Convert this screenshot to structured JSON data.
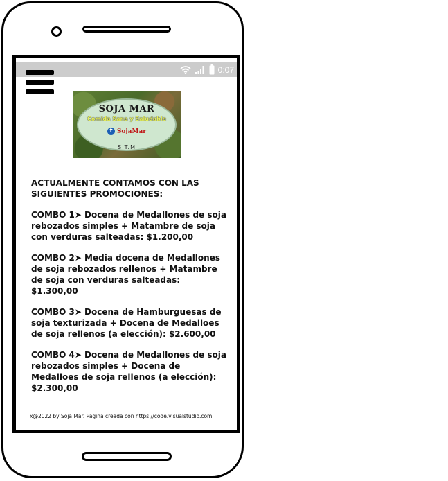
{
  "status_bar": {
    "icons": [
      "wifi-icon",
      "signal-icon",
      "battery-icon"
    ],
    "time": "0:07"
  },
  "logo": {
    "title": "SOJA MAR",
    "subtitle": "Comida Sana y Saludable",
    "social_handle": "SojaMar",
    "tag": "S.T.M"
  },
  "content": {
    "intro": "ACTUALMENTE CONTAMOS CON LAS SIGUIENTES PROMOCIONES:",
    "combos": [
      "COMBO 1➤ Docena de Medallones de soja rebozados simples + Matambre de soja con verduras salteadas: $1.200,00",
      "COMBO 2➤ Media docena de Medallones de soja rebozados rellenos + Matambre de soja con verduras salteadas: $1.300,00",
      "COMBO 3➤ Docena de Hamburguesas de soja texturizada + Docena de Medalloes de soja rellenos (a elección): $2.600,00",
      "COMBO 4➤ Docena de Medallones de soja rebozados simples + Docena de Medalloes de soja rellenos (a elección): $2.300,00"
    ]
  },
  "footer": {
    "text": "x@2022 by Soja Mar. Pagina creada con https://code.visualstudio.com"
  },
  "colors": {
    "status_bar_bg": "#cccccc",
    "text": "#111111",
    "frame": "#000000"
  }
}
